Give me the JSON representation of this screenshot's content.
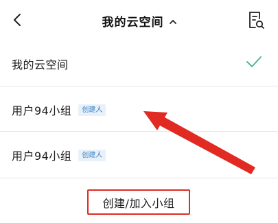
{
  "header": {
    "title": "我的云空间",
    "back_icon": "chevron-left-icon",
    "title_chevron_icon": "chevron-up-icon",
    "action_icon": "document-settings-icon"
  },
  "spaces": [
    {
      "label": "我的云空间",
      "selected": true,
      "badge": ""
    },
    {
      "label": "用户94小组",
      "selected": false,
      "badge": "创建人"
    },
    {
      "label": "用户94小组",
      "selected": false,
      "badge": "创建人"
    }
  ],
  "footer": {
    "create_join_label": "创建/加入小组"
  },
  "colors": {
    "check": "#4fb59c",
    "badge_text": "#3a7fbf",
    "badge_bg": "#e8f1fa",
    "annotation_red": "#e02a22"
  }
}
